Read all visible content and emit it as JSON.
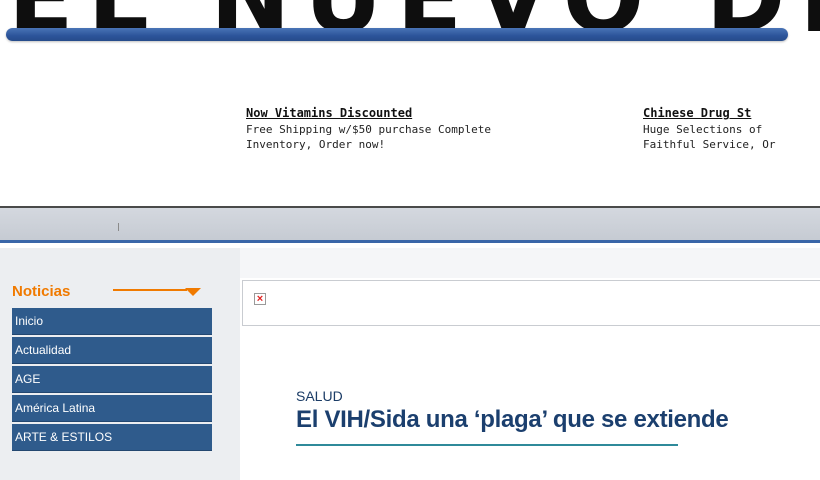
{
  "masthead": {
    "logo_text": "EL NUEVO DIARIO"
  },
  "ads": [
    {
      "title": "Now Vitamins Discounted",
      "line1": "Free Shipping w/$50 purchase Complete",
      "line2": "Inventory, Order now!"
    },
    {
      "title": "Chinese Drug St",
      "line1": "Huge Selections of",
      "line2": "Faithful Service, Or"
    }
  ],
  "sidebar": {
    "section_title": "Noticias",
    "items": [
      {
        "label": "Inicio"
      },
      {
        "label": "Actualidad"
      },
      {
        "label": "AGE"
      },
      {
        "label": "América Latina"
      },
      {
        "label": "ARTE & ESTILOS"
      }
    ]
  },
  "article": {
    "kicker": "SALUD",
    "headline": "El VIH/Sida una ‘plaga’ que se extiende"
  },
  "colors": {
    "accent_orange": "#f07a00",
    "menu_blue": "#2f5b8c",
    "headline_blue": "#1b3f6e",
    "broken_image_x": "#e02020"
  },
  "icons": {
    "broken_image": "broken-image-icon",
    "section_arrow": "dropdown-arrow-icon"
  }
}
